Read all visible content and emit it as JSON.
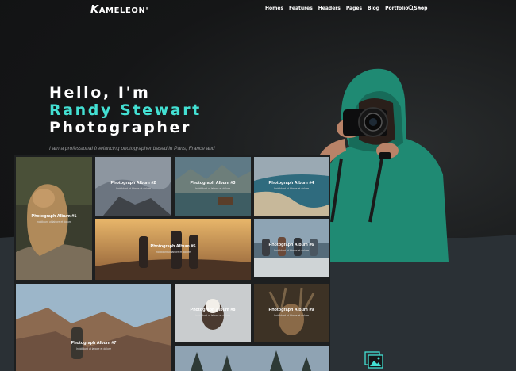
{
  "brand": {
    "logo_text": "AMELEON",
    "logo_k": "K",
    "logo_mark": "'"
  },
  "nav": {
    "items": [
      {
        "label": "Homes"
      },
      {
        "label": "Features"
      },
      {
        "label": "Headers"
      },
      {
        "label": "Pages"
      },
      {
        "label": "Blog"
      },
      {
        "label": "Portfolio"
      },
      {
        "label": "Shop"
      }
    ],
    "icons": [
      "search-icon",
      "hamburger-menu-icon"
    ]
  },
  "hero": {
    "greeting": "Hello, I'm",
    "name": "Randy Stewart",
    "role": "Photographer",
    "description": "I am a professional freelancing photographer based in Paris, France and now it's time for the"
  },
  "colors": {
    "accent": "#43e0d3",
    "background": "#161718",
    "wave": "#2a3035",
    "hoodie": "#1f8a73"
  },
  "gallery": {
    "albums": [
      {
        "title": "Photograph Album #1",
        "subtitle": "Incididunt ut labore et dolore"
      },
      {
        "title": "Photograph Album #2",
        "subtitle": "Incididunt ut labore et dolore"
      },
      {
        "title": "Photograph Album #3",
        "subtitle": "Incididunt ut labore et dolore"
      },
      {
        "title": "Photograph Album #4",
        "subtitle": "Incididunt ut labore et dolore"
      },
      {
        "title": "Photograph Album #5",
        "subtitle": "Incididunt ut labore et dolore"
      },
      {
        "title": "Photograph Album #6",
        "subtitle": "Incididunt ut labore et dolore"
      },
      {
        "title": "Photograph Album #7",
        "subtitle": "Incididunt ut labore et dolore"
      },
      {
        "title": "Photograph Album #8",
        "subtitle": "Incididunt ut labore et dolore"
      },
      {
        "title": "Photograph Album #9",
        "subtitle": "Incididunt ut labore et dolore"
      }
    ]
  },
  "bottom_icon": "image-gallery-icon"
}
